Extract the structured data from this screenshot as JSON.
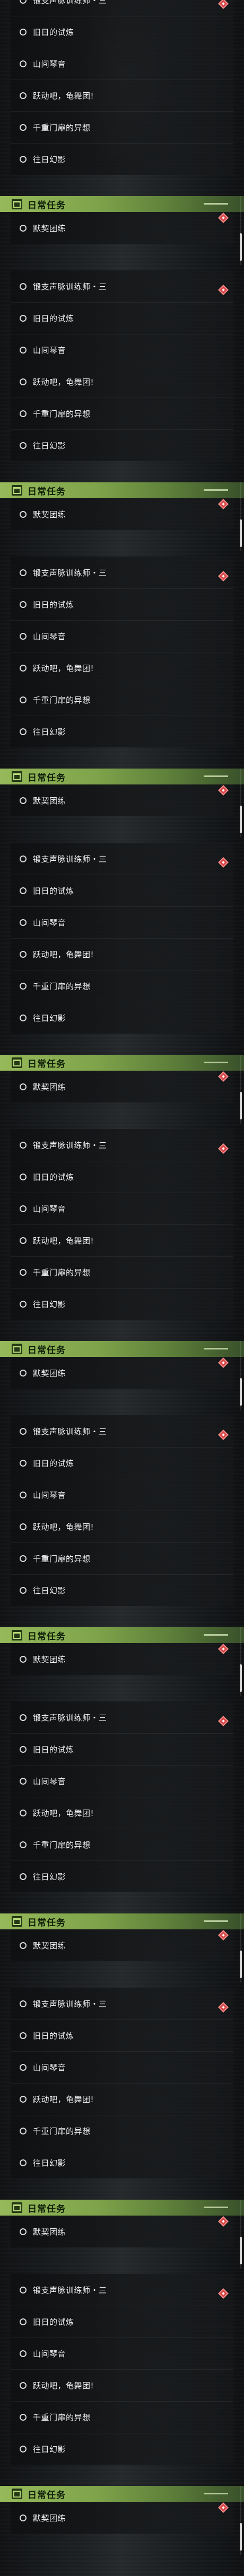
{
  "panels": [
    {
      "tasks": [
        "锻支声脉训练师・三",
        "旧日的试炼",
        "山间琴音",
        "跃动吧，龟舞团!",
        "千重门扉的异想",
        "往日幻影"
      ],
      "section_title": "日常任务",
      "daily_tasks": [
        "默契团练"
      ]
    },
    {
      "tasks": [
        "锻支声脉训练师・三",
        "旧日的试炼",
        "山间琴音",
        "跃动吧，龟舞团!",
        "千重门扉的异想",
        "往日幻影"
      ],
      "section_title": "日常任务",
      "daily_tasks": [
        "默契团练"
      ]
    },
    {
      "tasks": [
        "锻支声脉训练师・三",
        "旧日的试炼",
        "山间琴音",
        "跃动吧，龟舞团!",
        "千重门扉的异想",
        "往日幻影"
      ],
      "section_title": "日常任务",
      "daily_tasks": [
        "默契团练"
      ]
    },
    {
      "tasks": [
        "锻支声脉训练师・三",
        "旧日的试炼",
        "山间琴音",
        "跃动吧，龟舞团!",
        "千重门扉的异想",
        "往日幻影"
      ],
      "section_title": "日常任务",
      "daily_tasks": [
        "默契团练"
      ]
    },
    {
      "tasks": [
        "锻支声脉训练师・三",
        "旧日的试炼",
        "山间琴音",
        "跃动吧，龟舞团!",
        "千重门扉的异想",
        "往日幻影"
      ],
      "section_title": "日常任务",
      "daily_tasks": [
        "默契团练"
      ]
    },
    {
      "tasks": [
        "锻支声脉训练师・三",
        "旧日的试炼",
        "山间琴音",
        "跃动吧，龟舞团!",
        "千重门扉的异想",
        "往日幻影"
      ],
      "section_title": "日常任务",
      "daily_tasks": [
        "默契团练"
      ]
    },
    {
      "tasks": [
        "锻支声脉训练师・三",
        "旧日的试炼",
        "山间琴音",
        "跃动吧，龟舞团!",
        "千重门扉的异想",
        "往日幻影"
      ],
      "section_title": "日常任务",
      "daily_tasks": [
        "默契团练"
      ]
    },
    {
      "tasks": [
        "锻支声脉训练师・三",
        "旧日的试炼",
        "山间琴音",
        "跃动吧，龟舞团!",
        "千重门扉的异想",
        "往日幻影"
      ],
      "section_title": "日常任务",
      "daily_tasks": [
        "默契团练"
      ]
    },
    {
      "tasks": [
        "锻支声脉训练师・三",
        "旧日的试炼",
        "山间琴音",
        "跃动吧，龟舞团!",
        "千重门扉的异想",
        "往日幻影"
      ],
      "section_title": "日常任务",
      "daily_tasks": [
        "默契团练"
      ]
    }
  ],
  "colors": {
    "header_green": "#96b95a",
    "pin_red": "#d64747",
    "background": "#15171a"
  },
  "icons": {
    "task_status": "circle-icon",
    "pinned": "map-pin-icon",
    "section": "daily-task-icon"
  }
}
